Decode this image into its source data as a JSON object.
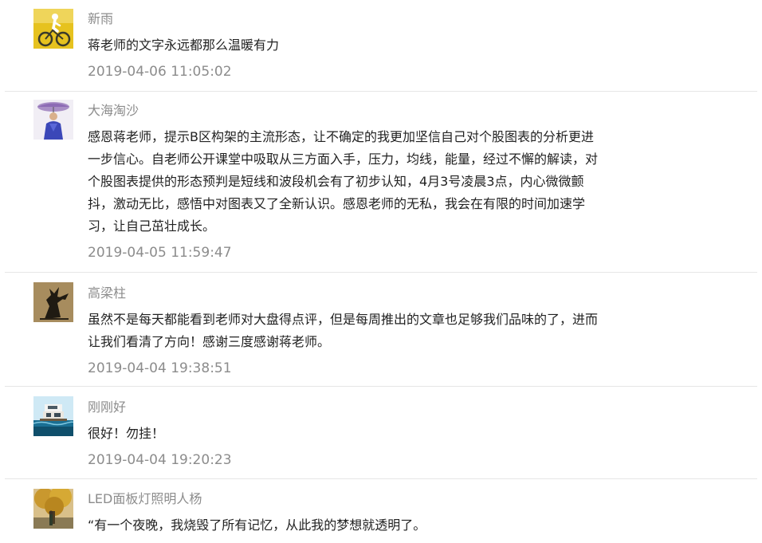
{
  "comments": [
    {
      "user": "新雨",
      "avatar": "cyclist-avatar",
      "content": "蒋老师的文字永远都那么温暖有力",
      "time": "2019-04-06 11:05:02"
    },
    {
      "user": "大海淘沙",
      "avatar": "person-umbrella-avatar",
      "content": "感恩蒋老师，提示B区构架的主流形态，让不确定的我更加坚信自己对个股图表的分析更进一步信心。自老师公开课堂中吸取从三方面入手，压力，均线，能量，经过不懈的解读，对个股图表提供的形态预判是短线和波段机会有了初步认知，4月3号凌晨3点，内心微微颤抖，激动无比，感悟中对图表又了全新认识。感恩老师的无私，我会在有限的时间加速学习，让自己茁壮成长。",
      "time": "2019-04-05 11:59:47"
    },
    {
      "user": "高梁柱",
      "avatar": "silhouette-art-avatar",
      "content": "虽然不是每天都能看到老师对大盘得点评，但是每周推出的文章也足够我们品味的了，进而让我们看清了方向！感谢三度感谢蒋老师。",
      "time": "2019-04-04 19:38:51"
    },
    {
      "user": "刚刚好",
      "avatar": "seaside-house-avatar",
      "content": "很好！勿挂！",
      "time": "2019-04-04 19:20:23"
    },
    {
      "user": "LED面板灯照明人杨",
      "avatar": "autumn-tree-avatar",
      "content": "“有一个夜晚，我烧毁了所有记忆，从此我的梦想就透明了。",
      "time": ""
    }
  ]
}
